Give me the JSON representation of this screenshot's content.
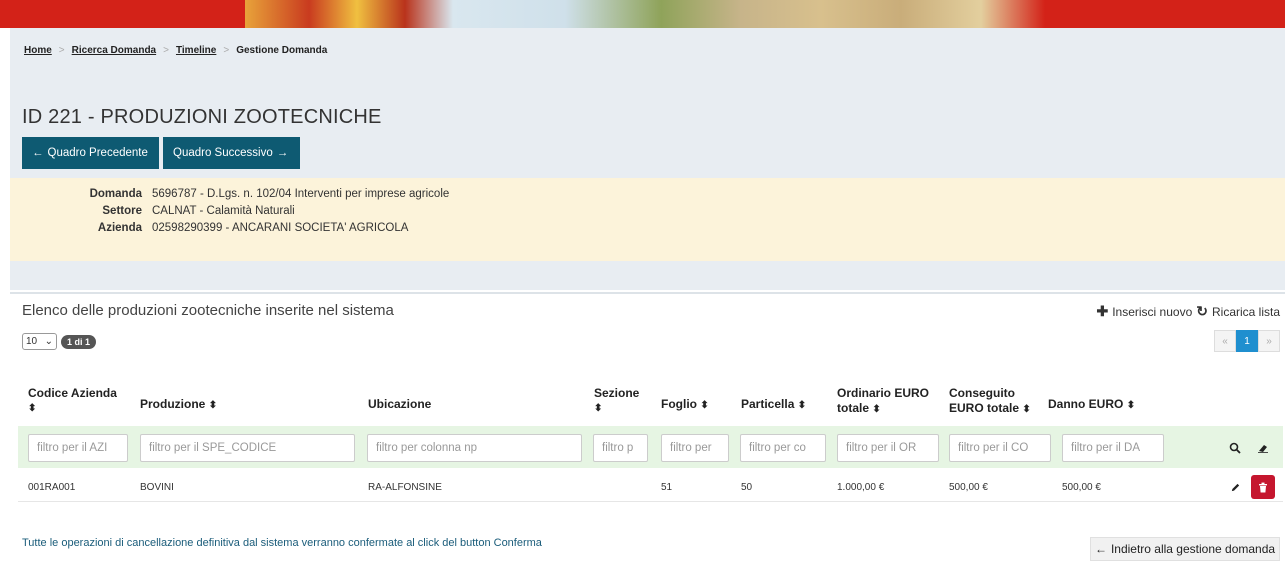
{
  "breadcrumb": [
    {
      "label": "Home"
    },
    {
      "label": "Ricerca Domanda"
    },
    {
      "label": "Timeline"
    },
    {
      "label": "Gestione Domanda"
    }
  ],
  "page_title": "ID 221 - PRODUZIONI ZOOTECNICHE",
  "nav": {
    "prev": "Quadro Precedente",
    "next": "Quadro Successivo"
  },
  "info": {
    "domanda_label": "Domanda",
    "domanda_code": "5696787",
    "domanda_text": " - D.Lgs. n. 102/04 Interventi per imprese agricole",
    "settore_label": "Settore",
    "settore_code": "CALNAT",
    "settore_text": " - Calamità Naturali",
    "azienda_label": "Azienda",
    "azienda_code": "02598290399",
    "azienda_text": " - ANCARANI SOCIETA' AGRICOLA"
  },
  "list": {
    "title": "Elenco delle produzioni zootecniche inserite nel sistema",
    "insert": "Inserisci nuovo",
    "reload": "Ricarica lista",
    "page_size": "10",
    "page_badge": "1 di 1",
    "pager": {
      "prev": "«",
      "current": "1",
      "next": "»"
    }
  },
  "columns": [
    {
      "l1": "Codice Azienda",
      "l2": ""
    },
    {
      "l1": "Produzione",
      "l2": ""
    },
    {
      "l1": "Ubicazione",
      "l2": ""
    },
    {
      "l1": "Sezione",
      "l2": ""
    },
    {
      "l1": "Foglio",
      "l2": ""
    },
    {
      "l1": "Particella",
      "l2": ""
    },
    {
      "l1": "Ordinario EURO",
      "l2": "totale"
    },
    {
      "l1": "Conseguito",
      "l2": "EURO totale"
    },
    {
      "l1": "Danno EURO",
      "l2": ""
    }
  ],
  "filters": [
    "filtro per il AZI",
    "filtro per il SPE_CODICE",
    "filtro per colonna np",
    "filtro p",
    "filtro per",
    "filtro per co",
    "filtro per il OR",
    "filtro per il CO",
    "filtro per il DA"
  ],
  "rows": [
    {
      "codice": "001RA001",
      "produzione": "BOVINI",
      "ubicazione": "RA-ALFONSINE",
      "sezione": "",
      "foglio": "51",
      "particella": "50",
      "ordinario": "1.000,00 €",
      "conseguito": "500,00 €",
      "danno": "500,00 €"
    }
  ],
  "note": "Tutte le operazioni di cancellazione definitiva dal sistema verranno confermate al click del button Conferma",
  "back": "Indietro alla gestione domanda",
  "icons": {
    "arrow_left": "←",
    "arrow_right": "→",
    "plus": "✚",
    "reload": "↻",
    "sort": "⬍",
    "search": "🔍",
    "eraser": "⌫",
    "edit": "✎",
    "trash": "🗑"
  }
}
